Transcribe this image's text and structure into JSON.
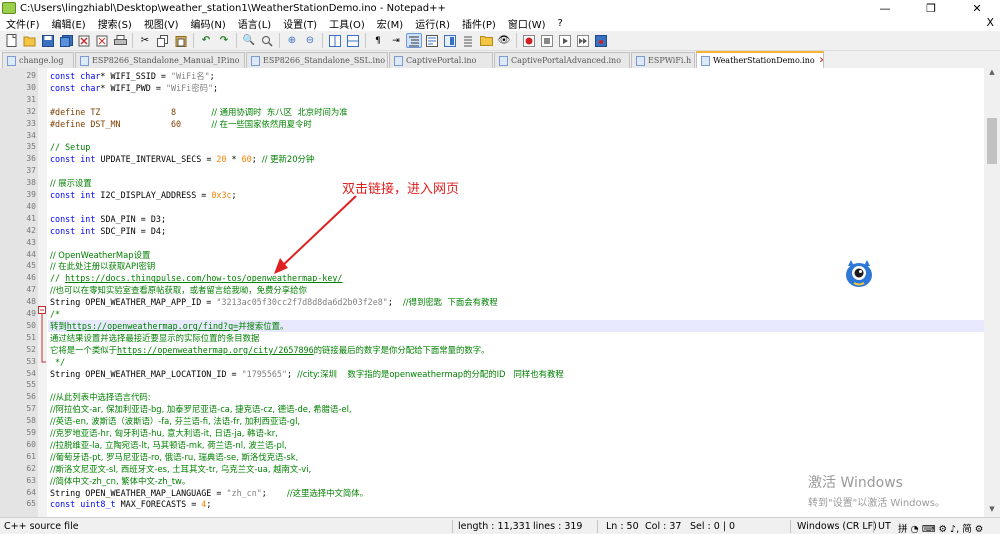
{
  "window": {
    "title": "C:\\Users\\lingzhiabl\\Desktop\\weather_station1\\WeatherStationDemo.ino - Notepad++",
    "minimize": "—",
    "maximize": "❐",
    "close": "✕"
  },
  "menu": [
    "文件(F)",
    "编辑(E)",
    "搜索(S)",
    "视图(V)",
    "编码(N)",
    "语言(L)",
    "设置(T)",
    "工具(O)",
    "宏(M)",
    "运行(R)",
    "插件(P)",
    "窗口(W)",
    "?"
  ],
  "menu_close": "X",
  "tabs": [
    {
      "label": "change.log",
      "active": false
    },
    {
      "label": "ESP8266_Standalone_Manual_IP.ino",
      "active": false
    },
    {
      "label": "ESP8266_Standalone_SSL.ino",
      "active": false
    },
    {
      "label": "CaptivePortal.ino",
      "active": false
    },
    {
      "label": "CaptivePortalAdvanced.ino",
      "active": false
    },
    {
      "label": "ESPWiFi.h",
      "active": false
    },
    {
      "label": "WeatherStationDemo.ino",
      "active": true
    }
  ],
  "code_lines": [
    {
      "n": "29",
      "html": "<span class=\"kw\">const char</span>* WIFI_SSID = <span class=\"str\">\"WiFi名\"</span>;"
    },
    {
      "n": "30",
      "html": "<span class=\"kw\">const char</span>* WIFI_PWD = <span class=\"str\">\"WiFi密码\"</span>;"
    },
    {
      "n": "31",
      "html": ""
    },
    {
      "n": "32",
      "html": "<span class=\"pp\">#define TZ              8</span>       <span class=\"cmt cn\">// 通用协调时  东八区  北京时间为准</span>"
    },
    {
      "n": "33",
      "html": "<span class=\"pp\">#define DST_MN          60</span>      <span class=\"cmt cn\">// 在一些国家依然用夏令时</span>"
    },
    {
      "n": "34",
      "html": ""
    },
    {
      "n": "35",
      "html": "<span class=\"cmt\">// Setup</span>"
    },
    {
      "n": "36",
      "html": "<span class=\"kw\">const int</span> UPDATE_INTERVAL_SECS = <span class=\"num\">20</span> * <span class=\"num\">60</span>; <span class=\"cmt cn\">// 更新20分钟</span>"
    },
    {
      "n": "37",
      "html": ""
    },
    {
      "n": "38",
      "html": "<span class=\"cmt cn\">// 展示设置</span>"
    },
    {
      "n": "39",
      "html": "<span class=\"kw\">const int</span> I2C_DISPLAY_ADDRESS = <span class=\"num\">0x3c</span>;"
    },
    {
      "n": "40",
      "html": ""
    },
    {
      "n": "41",
      "html": "<span class=\"kw\">const int</span> SDA_PIN = D3;"
    },
    {
      "n": "42",
      "html": "<span class=\"kw\">const int</span> SDC_PIN = D4;"
    },
    {
      "n": "43",
      "html": ""
    },
    {
      "n": "44",
      "html": "<span class=\"cmt cn\">// OpenWeatherMap设置</span>"
    },
    {
      "n": "45",
      "html": "<span class=\"cmt cn\">// 在此处注册以获取API密钥</span>"
    },
    {
      "n": "46",
      "html": "<span class=\"cmt\">// </span><span class=\"url\">https://docs.thingpulse.com/how-tos/openweathermap-key/</span>"
    },
    {
      "n": "47",
      "html": "<span class=\"cmt cn\">//也可以在零知实验室查看原帖获取，或者留言给我呦，免费分享给你</span>"
    },
    {
      "n": "48",
      "html": "String OPEN_WEATHER_MAP_APP_ID = <span class=\"str\">\"3213ac05f30cc2f7d8d8da6d2b03f2e8\"</span>;  <span class=\"cmt cn\">//得到密匙  下面会有教程</span>"
    },
    {
      "n": "49",
      "html": "<span class=\"cmt\">/*</span>"
    },
    {
      "n": "50",
      "html": "<span class=\"cmt cn\">转到</span><span class=\"url\">https://openweathermap.org/find?q=</span><span class=\"cmt cn\">并搜索位置。</span>"
    },
    {
      "n": "51",
      "html": "<span class=\"cmt cn\">通过结果设置并选择最接近要显示的实际位置的条目数据</span>"
    },
    {
      "n": "52",
      "html": "<span class=\"cmt cn\">它将是一个类似于</span><span class=\"url\">https://openweathermap.org/city/2657896</span><span class=\"cmt cn\">的链接最后的数字是你分配给下面常量的数字。</span>"
    },
    {
      "n": "53",
      "html": "<span class=\"cmt\"> */</span>"
    },
    {
      "n": "54",
      "html": "String OPEN_WEATHER_MAP_LOCATION_ID = <span class=\"str\">\"1795565\"</span>; <span class=\"cmt cn\">//city:深圳    数字指的是openweathermap的分配的ID   同样也有教程</span>"
    },
    {
      "n": "55",
      "html": ""
    },
    {
      "n": "56",
      "html": "<span class=\"cmt cn\">//从此列表中选择语言代码:</span>"
    },
    {
      "n": "57",
      "html": "<span class=\"cmt cn\">//阿拉伯文-ar, 保加利亚语-bg, 加泰罗尼亚语-ca, 捷克语-cz, 德语-de, 希腊语-el,</span>"
    },
    {
      "n": "58",
      "html": "<span class=\"cmt cn\">//英语-en, 波斯语（波斯语）-fa, 芬兰语-fi, 法语-fr, 加利西亚语-gl,</span>"
    },
    {
      "n": "59",
      "html": "<span class=\"cmt cn\">//克罗地亚语-hr, 匈牙利语-hu, 意大利语-it, 日语-ja, 韩语-kr,</span>"
    },
    {
      "n": "60",
      "html": "<span class=\"cmt cn\">//拉脱维亚-la, 立陶宛语-lt, 马其顿语-mk, 荷兰语-nl, 波兰语-pl,</span>"
    },
    {
      "n": "61",
      "html": "<span class=\"cmt cn\">//葡萄牙语-pt, 罗马尼亚语-ro, 俄语-ru, 瑞典语-se, 斯洛伐克语-sk,</span>"
    },
    {
      "n": "62",
      "html": "<span class=\"cmt cn\">//斯洛文尼亚文-sl, 西班牙文-es, 土耳其文-tr, 乌克兰文-ua, 越南文-vi,</span>"
    },
    {
      "n": "63",
      "html": "<span class=\"cmt cn\">//简体中文-zh_cn, 繁体中文-zh_tw。</span>"
    },
    {
      "n": "64",
      "html": "String OPEN_WEATHER_MAP_LANGUAGE = <span class=\"str\">\"zh_cn\"</span>;    <span class=\"cmt cn\">//这里选择中文简体。</span>"
    },
    {
      "n": "65",
      "html": "<span class=\"kw\">const uint8_t</span> MAX_FORECASTS = <span class=\"num\">4</span>;"
    }
  ],
  "annotation": "双击链接，进入网页",
  "watermark": {
    "line1": "激活 Windows",
    "line2": "转到\"设置\"以激活 Windows。"
  },
  "status": {
    "file_type": "C++ source file",
    "length": "length : 11,331",
    "lines": "lines : 319",
    "ln": "Ln : 50",
    "col": "Col : 37",
    "sel": "Sel : 0 | 0",
    "eol": "Windows (CR LF)",
    "encoding": "UT",
    "ime": "拼  ◔ ⌨ ⚙ ♪, 简 ⚙"
  }
}
